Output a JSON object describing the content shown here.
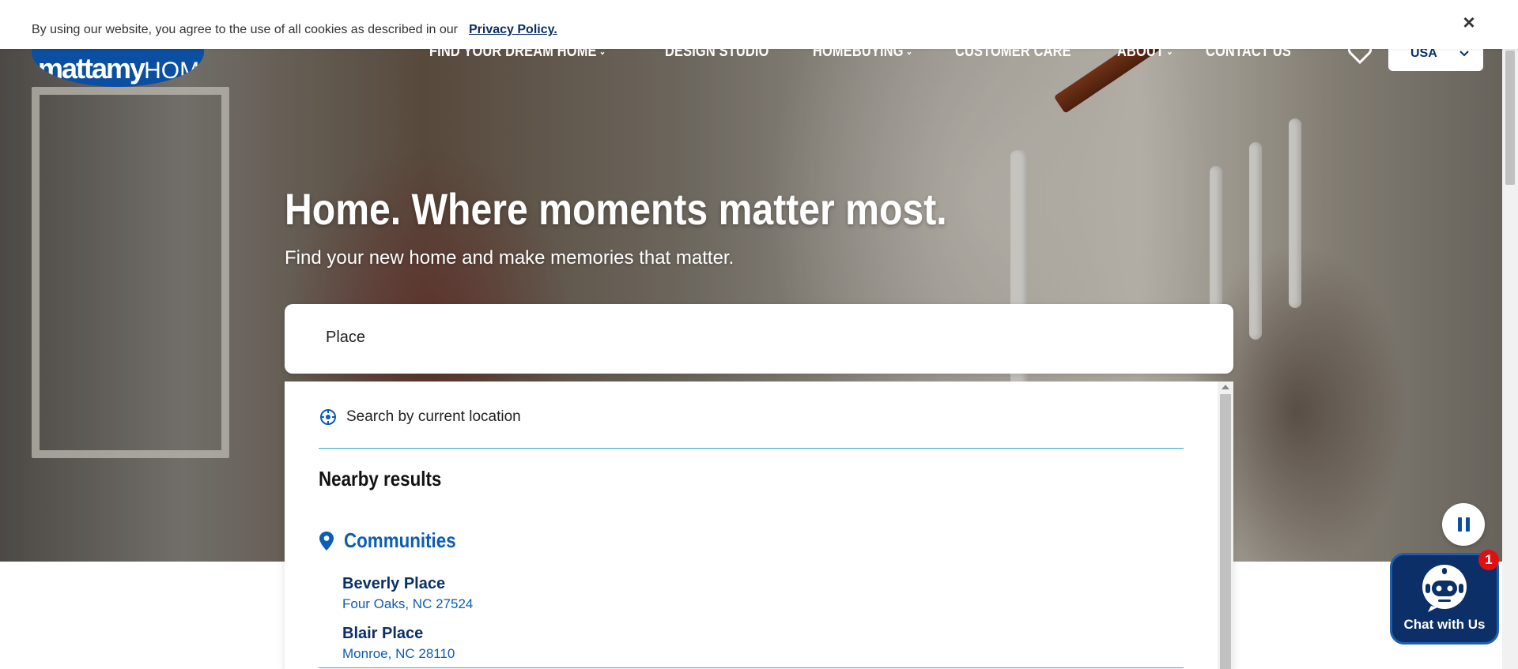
{
  "cookie": {
    "text": "By using our website, you agree to the use of all cookies as described in our",
    "link_label": "Privacy Policy.",
    "close_label": "×"
  },
  "header": {
    "logo_text_bold": "mattamy",
    "logo_text_light": "HOMES",
    "nav": [
      {
        "label": "FIND YOUR DREAM HOME",
        "has_dropdown": true
      },
      {
        "label": "DESIGN STUDIO",
        "has_dropdown": false
      },
      {
        "label": "HOMEBUYING",
        "has_dropdown": true
      },
      {
        "label": "CUSTOMER CARE",
        "has_dropdown": false
      },
      {
        "label": "ABOUT",
        "has_dropdown": true
      },
      {
        "label": "CONTACT US",
        "has_dropdown": false
      }
    ],
    "country": "USA"
  },
  "hero": {
    "title": "Home. Where moments matter most.",
    "subtitle": "Find your new home and make memories that matter."
  },
  "search": {
    "value": "Place",
    "current_location_label": "Search by current location",
    "nearby_title": "Nearby results",
    "category_label": "Communities",
    "results": [
      {
        "name": "Beverly Place",
        "location": "Four Oaks, NC 27524"
      },
      {
        "name": "Blair Place",
        "location": "Monroe, NC 28110"
      }
    ]
  },
  "chat": {
    "label": "Chat with Us",
    "badge_count": "1"
  },
  "colors": {
    "brand_navy": "#0b2f66",
    "brand_blue": "#0b5db5",
    "divider_teal": "#3aa7c8",
    "badge_red": "#e01010"
  }
}
